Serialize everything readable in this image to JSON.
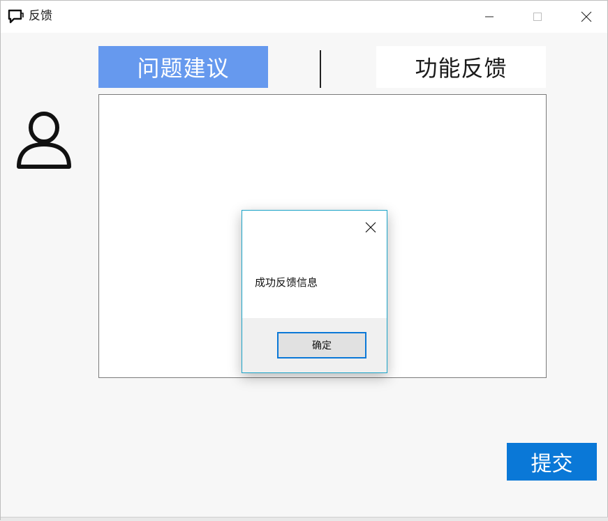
{
  "window": {
    "title": "反馈",
    "icons": {
      "app": "chat-bubble-icon",
      "minimize": "minimize-icon",
      "maximize": "maximize-icon",
      "close": "close-icon"
    }
  },
  "tabs": {
    "active_label": "问题建议",
    "inactive_label": "功能反馈"
  },
  "feedback": {
    "text_value": ""
  },
  "submit": {
    "label": "提交"
  },
  "dialog": {
    "message": "成功反馈信息",
    "ok_label": "确定",
    "close_icon": "close-icon"
  },
  "colors": {
    "tab_active_bg": "#6699ee",
    "submit_bg": "#0a78d7",
    "dialog_border": "#1aa3c8"
  }
}
